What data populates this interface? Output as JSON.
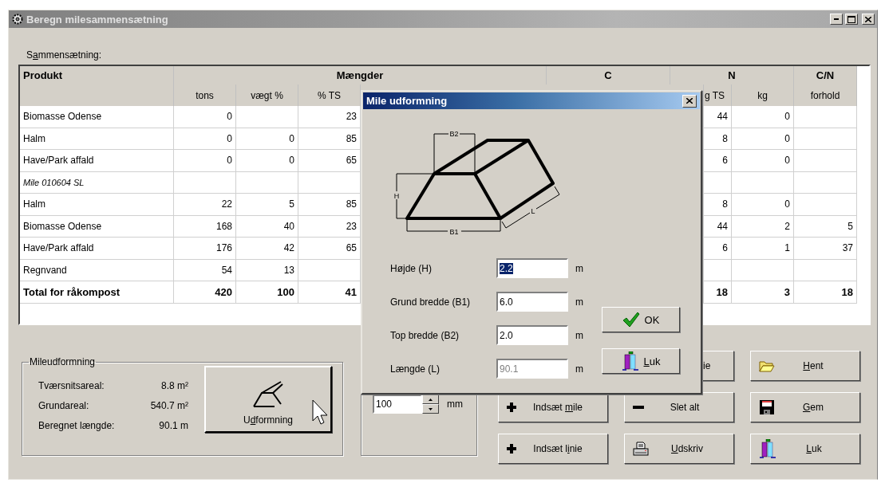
{
  "window": {
    "title": "Beregn milesammensætning"
  },
  "composition": {
    "label": "Sammensætning:",
    "groups": [
      "Produkt",
      "Mængder",
      "C",
      "N",
      "C/N"
    ],
    "columns": [
      "tons",
      "vægt %",
      "% TS",
      "g TS",
      "kg",
      "forhold"
    ],
    "rows": [
      {
        "kind": "item",
        "cells": [
          "Biomasse Odense",
          "0",
          "",
          "23",
          "44",
          "0",
          ""
        ]
      },
      {
        "kind": "item",
        "cells": [
          "Halm",
          "0",
          "0",
          "85",
          "8",
          "0",
          ""
        ]
      },
      {
        "kind": "item",
        "cells": [
          "Have/Park affald",
          "0",
          "0",
          "65",
          "6",
          "0",
          ""
        ]
      },
      {
        "kind": "group",
        "cells": [
          "Mile 010604 SL",
          "",
          "",
          "",
          "",
          "",
          ""
        ]
      },
      {
        "kind": "item",
        "cells": [
          "Halm",
          "22",
          "5",
          "85",
          "8",
          "0",
          ""
        ]
      },
      {
        "kind": "item",
        "cells": [
          "Biomasse Odense",
          "168",
          "40",
          "23",
          "44",
          "2",
          "5"
        ]
      },
      {
        "kind": "item",
        "cells": [
          "Have/Park affald",
          "176",
          "42",
          "65",
          "6",
          "1",
          "37"
        ]
      },
      {
        "kind": "item",
        "cells": [
          "Regnvand",
          "54",
          "13",
          "",
          "",
          "",
          ""
        ]
      },
      {
        "kind": "total",
        "cells": [
          "Total for råkompost",
          "420",
          "100",
          "41",
          "18",
          "3",
          "18"
        ]
      }
    ]
  },
  "pile_shape": {
    "title": "Mileudformning",
    "stats": [
      {
        "label": "Tværsnitsareal:",
        "value": "8.8 m²"
      },
      {
        "label": "Grundareal:",
        "value": "540.7 m²"
      },
      {
        "label": "Beregnet længde:",
        "value": "90.1 m"
      }
    ],
    "button": {
      "label": "Udformning"
    }
  },
  "spacing": {
    "value": "100",
    "unit": "mm"
  },
  "buttons": [
    {
      "label": "ie"
    },
    {
      "label": "Hent"
    },
    {
      "label": "Indsæt mile"
    },
    {
      "label": "Slet alt"
    },
    {
      "label": "Gem"
    },
    {
      "label": "Indsæt linie"
    },
    {
      "label": "Udskriv"
    },
    {
      "label": "Luk"
    }
  ],
  "dialog": {
    "title": "Mile udformning",
    "diagram_labels": [
      "B2",
      "H",
      "L",
      "B1"
    ],
    "fields": [
      {
        "label": "Højde (H)",
        "value": "2.2",
        "unit": "m",
        "selected": true,
        "disabled": false
      },
      {
        "label": "Grund bredde (B1)",
        "value": "6.0",
        "unit": "m",
        "selected": false,
        "disabled": false
      },
      {
        "label": "Top bredde (B2)",
        "value": "2.0",
        "unit": "m",
        "selected": false,
        "disabled": false
      },
      {
        "label": "Længde (L)",
        "value": "90.1",
        "unit": "m",
        "selected": false,
        "disabled": true
      }
    ],
    "buttons": [
      {
        "label": "OK"
      },
      {
        "label": "Luk"
      }
    ]
  }
}
